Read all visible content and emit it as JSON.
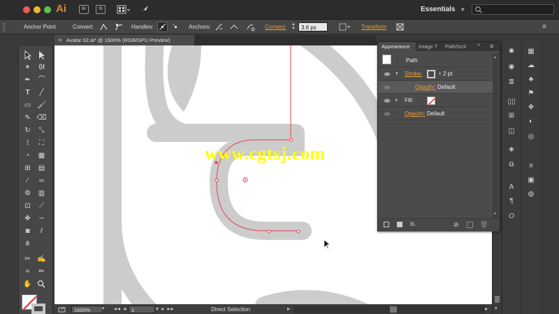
{
  "app": {
    "logo": "Ai",
    "tb_icon_br": "Br",
    "tb_icon_st": "St",
    "workspace": "Essentials",
    "workspace_arrow": "▾",
    "search_placeholder": ""
  },
  "control_bar": {
    "anchor_point": "Anchor Point",
    "convert": "Convert:",
    "handles": "Handles:",
    "anchors": "Anchors:",
    "corners": "Corners:",
    "corners_value": "3.6 px",
    "transform": "Transform"
  },
  "document_tab": {
    "title": "Avatar 02.ai* @ 1600% (RGB/GPU Preview)",
    "close": "✕"
  },
  "appearance_panel": {
    "tabs": [
      "Appearance",
      "Image T",
      "PathScril"
    ],
    "menu_icon": "≡",
    "object_type": "Path",
    "stroke_label": "Stroke:",
    "stroke_weight": "2 pt",
    "stroke_opacity_label": "Opacity:",
    "stroke_opacity_value": "Default",
    "fill_label": "Fill:",
    "opacity_label": "Opacity:",
    "opacity_value": "Default",
    "footer_fx": "fx."
  },
  "status_bar": {
    "zoom": "1600%",
    "artboard": "1",
    "tool": "Direct Selection"
  },
  "watermark": "www.cgtsj.com",
  "colors": {
    "accent_orange": "#e8a03a",
    "path_red": "#e8424a",
    "art_gray": "#cccccc",
    "watermark_yellow": "#ffff00"
  }
}
